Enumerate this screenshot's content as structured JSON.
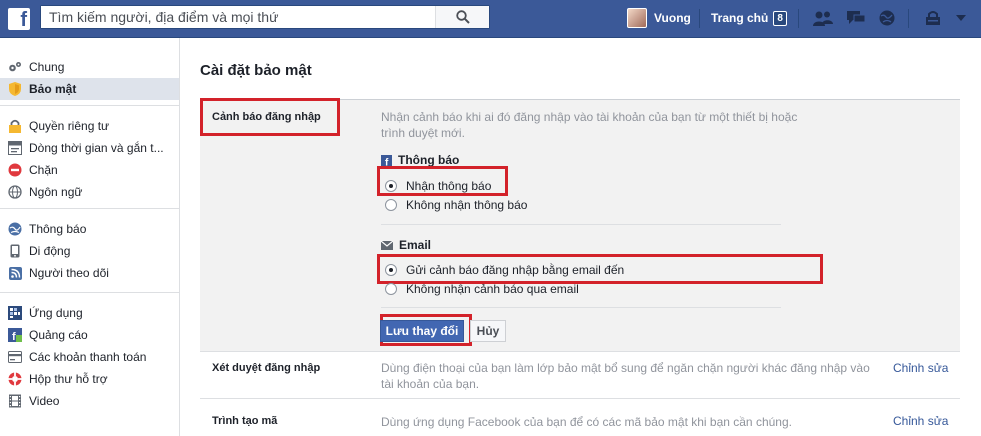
{
  "topbar": {
    "logo": "f",
    "search_placeholder": "Tìm kiếm người, địa điểm và mọi thứ",
    "user_name": "Vuong",
    "home_label": "Trang chủ",
    "home_badge": "8"
  },
  "sidebar": {
    "groups": [
      [
        {
          "label": "Chung",
          "icon": "gear-icon"
        },
        {
          "label": "Bảo mật",
          "icon": "shield-icon",
          "active": true
        }
      ],
      [
        {
          "label": "Quyền riêng tư",
          "icon": "lock-icon"
        },
        {
          "label": "Dòng thời gian và gắn t...",
          "icon": "timeline-icon"
        },
        {
          "label": "Chặn",
          "icon": "block-icon"
        },
        {
          "label": "Ngôn ngữ",
          "icon": "globe-icon"
        }
      ],
      [
        {
          "label": "Thông báo",
          "icon": "globe-notification-icon"
        },
        {
          "label": "Di động",
          "icon": "mobile-icon"
        },
        {
          "label": "Người theo dõi",
          "icon": "rss-icon"
        }
      ],
      [
        {
          "label": "Ứng dụng",
          "icon": "apps-icon"
        },
        {
          "label": "Quảng cáo",
          "icon": "ads-icon"
        },
        {
          "label": "Các khoản thanh toán",
          "icon": "payment-icon"
        },
        {
          "label": "Hộp thư hỗ trợ",
          "icon": "lifebuoy-icon"
        },
        {
          "label": "Video",
          "icon": "film-icon"
        }
      ]
    ]
  },
  "main": {
    "title": "Cài đặt bảo mật",
    "login_alerts": {
      "label": "Cảnh báo đăng nhập",
      "description": "Nhận cảnh báo khi ai đó đăng nhập vào tài khoản của bạn từ một thiết bị hoặc trình duyệt mới.",
      "notifications_heading": "Thông báo",
      "notif_on": "Nhận thông báo",
      "notif_off": "Không nhận thông báo",
      "email_heading": "Email",
      "email_on": "Gửi cảnh báo đăng nhập bằng email đến",
      "email_off": "Không nhận cảnh báo qua email",
      "save": "Lưu thay đổi",
      "cancel": "Hủy"
    },
    "login_approvals": {
      "label": "Xét duyệt đăng nhập",
      "description": "Dùng điện thoại của bạn làm lớp bảo mật bổ sung để ngăn chặn người khác đăng nhập vào tài khoản của bạn.",
      "edit": "Chỉnh sửa"
    },
    "code_generator": {
      "label": "Trình tạo mã",
      "description": "Dùng ứng dụng Facebook của bạn để có các mã bảo mật khi bạn cần chúng.",
      "edit": "Chỉnh sửa"
    }
  },
  "colors": {
    "brand": "#3b5998",
    "highlight_box": "#d3222a",
    "link": "#365899"
  }
}
